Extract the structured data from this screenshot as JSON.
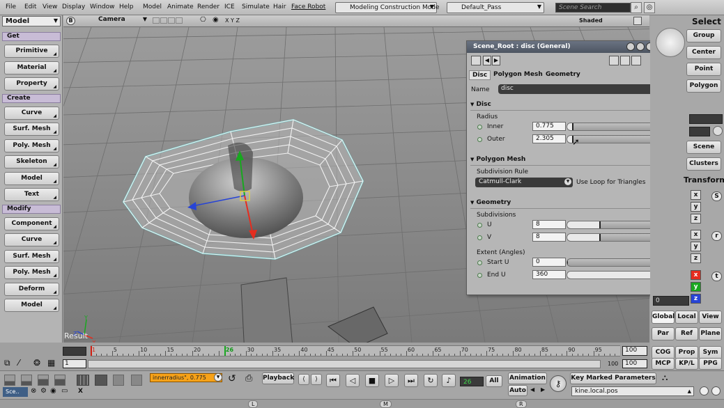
{
  "menubar": {
    "items": [
      "File",
      "Edit",
      "View",
      "Display",
      "Window",
      "Help",
      "Model",
      "Animate",
      "Render",
      "ICE",
      "Simulate",
      "Hair",
      "Face Robot"
    ],
    "construction_mode": "Modeling Construction Mode",
    "pass": "Default_Pass",
    "search_placeholder": "Scene Search"
  },
  "left_panel": {
    "mode": "Model",
    "sections": [
      {
        "header": "Get",
        "buttons": [
          "Primitive",
          "Material",
          "Property"
        ]
      },
      {
        "header": "Create",
        "buttons": [
          "Curve",
          "Surf. Mesh",
          "Poly. Mesh",
          "Skeleton",
          "Model",
          "Text"
        ]
      },
      {
        "header": "Modify",
        "buttons": [
          "Component",
          "Curve",
          "Surf. Mesh",
          "Poly. Mesh",
          "Deform",
          "Model"
        ]
      }
    ]
  },
  "viewport": {
    "letter": "B",
    "camera": "Camera",
    "axes": "X Y Z",
    "display_mode": "Shaded",
    "result_label": "Result"
  },
  "ppg": {
    "title": "Scene_Root : disc (General)",
    "tabs": [
      "Disc",
      "Polygon Mesh",
      "Geometry"
    ],
    "name_label": "Name",
    "name_value": "disc",
    "disc": {
      "header": "Disc",
      "group": "Radius",
      "inner_label": "Inner",
      "inner_value": "0.775",
      "inner_fraction": 0.05,
      "outer_label": "Outer",
      "outer_value": "2.305",
      "outer_fraction": 0.05
    },
    "polygon_mesh": {
      "header": "Polygon Mesh",
      "group": "Subdivision Rule",
      "rule": "Catmull-Clark",
      "loop_label": "Use Loop for Triangles"
    },
    "geometry": {
      "header": "Geometry",
      "subdiv_group": "Subdivisions",
      "u_label": "U",
      "u_value": "8",
      "u_fraction": 0.3,
      "v_label": "V",
      "v_value": "8",
      "v_fraction": 0.3,
      "extent_group": "Extent (Angles)",
      "start_label": "Start U",
      "start_value": "0",
      "start_fraction": 0.0,
      "end_label": "End U",
      "end_value": "360",
      "end_fraction": 1.0
    },
    "help": "?"
  },
  "right_panel": {
    "select_label": "Select",
    "buttons": [
      "Group",
      "Center",
      "Point",
      "Polygon"
    ],
    "scene": "Scene",
    "clusters": "Clusters",
    "transform": "Transform",
    "value_field": "0",
    "axes_s": [
      "x",
      "y",
      "z"
    ],
    "axes_r": [
      "x",
      "y",
      "z"
    ],
    "axes_t": [
      "x",
      "y",
      "z"
    ],
    "transform_keys": [
      "S",
      "r",
      "t"
    ],
    "ref_row1": [
      "Global",
      "Local",
      "View"
    ],
    "ref_row2": [
      "Par",
      "Ref",
      "Plane"
    ],
    "ref_row3": [
      "COG",
      "Prop",
      "Sym"
    ],
    "ref_row4": [
      "MCP",
      "KP/L",
      "PPG"
    ]
  },
  "timeline": {
    "start": "1",
    "start2": "1",
    "ticks": [
      "5",
      "10",
      "15",
      "20",
      "26",
      "30",
      "35",
      "40",
      "45",
      "50",
      "55",
      "60",
      "65",
      "70",
      "75",
      "80",
      "85",
      "90",
      "95"
    ],
    "current_frame": "26",
    "end": "100",
    "end_a": "100",
    "end_b": "100"
  },
  "bottombar": {
    "explorer_label": "Sce..",
    "close_label": "X",
    "command_field": "innerradius\", 0.775",
    "playback": "Playback",
    "frame_field": "26",
    "all_label": "All",
    "animation": "Animation",
    "auto": "Auto",
    "key_marked": "Key Marked Parameters",
    "kine_field": "kine.local.pos",
    "mouse_l": "L",
    "mouse_m": "M",
    "mouse_r": "R"
  },
  "colors": {
    "accent_red": "#e52d1f",
    "accent_green": "#18a81f",
    "accent_blue": "#2744d6",
    "ppg_title": "#56606d"
  }
}
